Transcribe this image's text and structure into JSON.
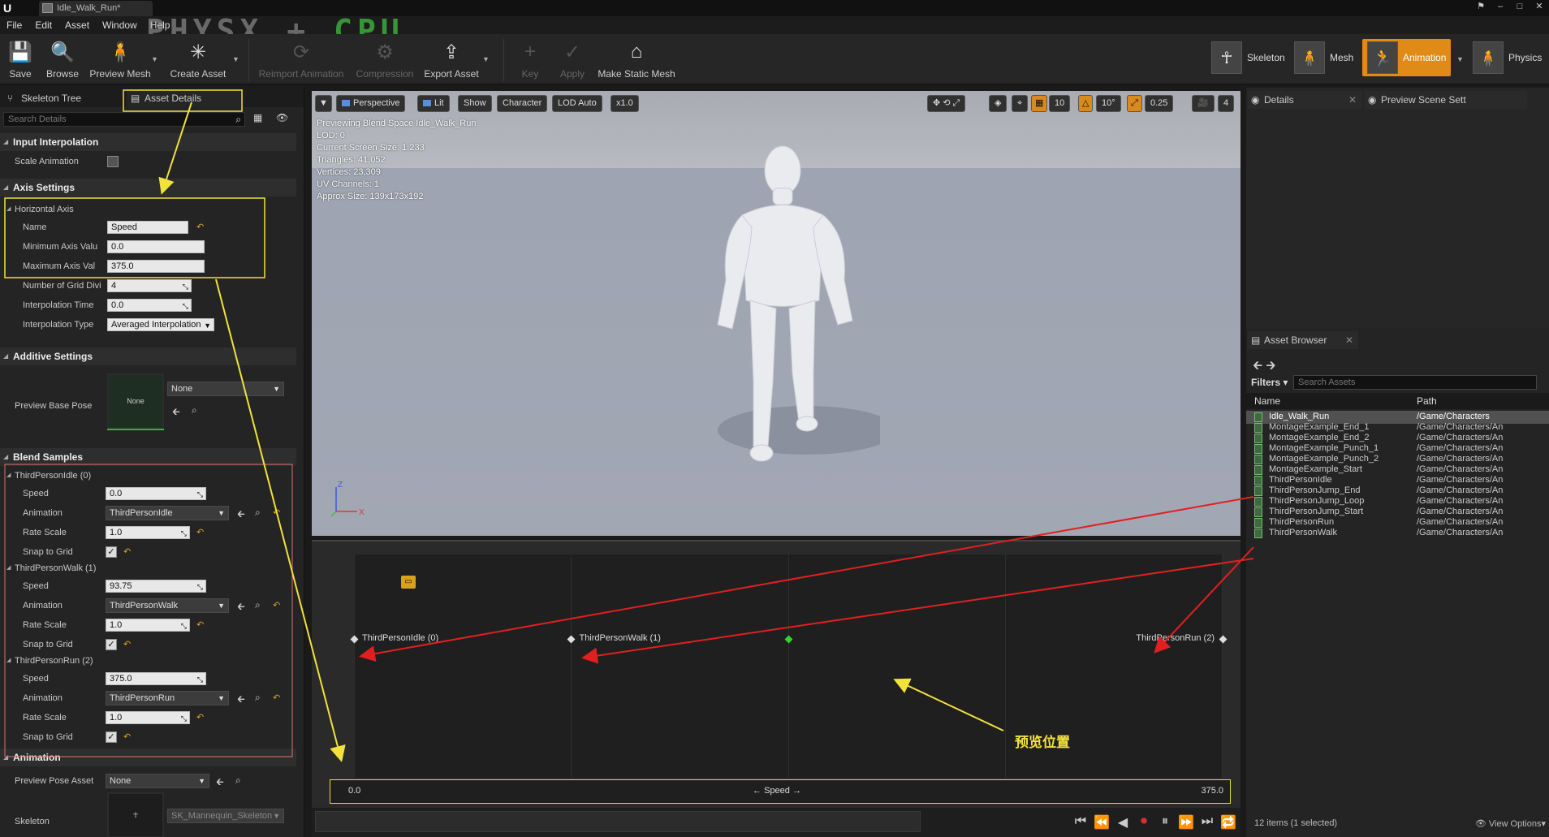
{
  "window": {
    "tab_title": "Idle_Walk_Run*",
    "watermark_left": "PHYSX",
    "watermark_plus": "+",
    "watermark_right": "CPU"
  },
  "menu": [
    "File",
    "Edit",
    "Asset",
    "Window",
    "Help"
  ],
  "toolbar": {
    "save": "Save",
    "browse": "Browse",
    "preview_mesh": "Preview Mesh",
    "create_asset": "Create Asset",
    "reimport_animation": "Reimport Animation",
    "compression": "Compression",
    "export_asset": "Export Asset",
    "key": "Key",
    "apply": "Apply",
    "make_static_mesh": "Make Static Mesh"
  },
  "modes": {
    "skeleton": "Skeleton",
    "mesh": "Mesh",
    "animation": "Animation",
    "physics": "Physics"
  },
  "left_panel": {
    "tab_skeleton_tree": "Skeleton Tree",
    "tab_asset_details": "Asset Details",
    "search_placeholder": "Search Details",
    "input_interpolation": "Input Interpolation",
    "scale_animation": "Scale Animation",
    "axis_settings": "Axis Settings",
    "horizontal_axis": "Horizontal Axis",
    "name_label": "Name",
    "name_value": "Speed",
    "min_axis_label": "Minimum Axis Valu",
    "min_axis_value": "0.0",
    "max_axis_label": "Maximum Axis Val",
    "max_axis_value": "375.0",
    "grid_div_label": "Number of Grid Divi",
    "grid_div_value": "4",
    "interp_time_label": "Interpolation Time",
    "interp_time_value": "0.0",
    "interp_type_label": "Interpolation Type",
    "interp_type_value": "Averaged Interpolation",
    "additive_settings": "Additive Settings",
    "preview_base_pose": "Preview Base Pose",
    "thumb_none": "None",
    "base_pose_value": "None",
    "blend_samples": "Blend Samples",
    "samples": [
      {
        "header": "ThirdPersonIdle (0)",
        "speed": "0.0",
        "animation": "ThirdPersonIdle",
        "rate": "1.0"
      },
      {
        "header": "ThirdPersonWalk (1)",
        "speed": "93.75",
        "animation": "ThirdPersonWalk",
        "rate": "1.0"
      },
      {
        "header": "ThirdPersonRun (2)",
        "speed": "375.0",
        "animation": "ThirdPersonRun",
        "rate": "1.0"
      }
    ],
    "speed_label": "Speed",
    "animation_label": "Animation",
    "rate_label": "Rate Scale",
    "snap_label": "Snap to Grid",
    "animation_cat": "Animation",
    "preview_pose_asset": "Preview Pose Asset",
    "preview_pose_value": "None",
    "skeleton_label": "Skeleton",
    "skeleton_value": "SK_Mannequin_Skeleton"
  },
  "viewport": {
    "perspective": "Perspective",
    "lit": "Lit",
    "show": "Show",
    "character": "Character",
    "lod": "LOD Auto",
    "speed": "x1.0",
    "grid_snap": "10",
    "rot_snap": "10°",
    "scale_snap": "0.25",
    "cam_speed": "4",
    "stats": [
      "Previewing Blend Space Idle_Walk_Run",
      "LOD: 0",
      "Current Screen Size: 1.233",
      "Triangles: 41,052",
      "Vertices: 23,309",
      "UV Channels: 1",
      "Approx Size: 139x173x192"
    ],
    "axis_z": "Z",
    "axis_x": "X"
  },
  "blend_space": {
    "samples": [
      {
        "label": "ThirdPersonIdle (0)",
        "speed": 0.0
      },
      {
        "label": "ThirdPersonWalk (1)",
        "speed": 93.75
      },
      {
        "label": "ThirdPersonRun (2)",
        "speed": 375.0
      }
    ],
    "preview_speed": 187.5,
    "axis_min": "0.0",
    "axis_max": "375.0",
    "axis_name": "Speed",
    "arrow_left": "←",
    "arrow_right": "→",
    "annotation": "预览位置"
  },
  "right_panel": {
    "tab_details": "Details",
    "tab_preview_scene": "Preview Scene Sett",
    "tab_asset_browser": "Asset Browser",
    "filters": "Filters",
    "search_placeholder": "Search Assets",
    "col_name": "Name",
    "col_path": "Path",
    "assets": [
      {
        "name": "Idle_Walk_Run",
        "path": "/Game/Characters"
      },
      {
        "name": "MontageExample_End_1",
        "path": "/Game/Characters/An"
      },
      {
        "name": "MontageExample_End_2",
        "path": "/Game/Characters/An"
      },
      {
        "name": "MontageExample_Punch_1",
        "path": "/Game/Characters/An"
      },
      {
        "name": "MontageExample_Punch_2",
        "path": "/Game/Characters/An"
      },
      {
        "name": "MontageExample_Start",
        "path": "/Game/Characters/An"
      },
      {
        "name": "ThirdPersonIdle",
        "path": "/Game/Characters/An"
      },
      {
        "name": "ThirdPersonJump_End",
        "path": "/Game/Characters/An"
      },
      {
        "name": "ThirdPersonJump_Loop",
        "path": "/Game/Characters/An"
      },
      {
        "name": "ThirdPersonJump_Start",
        "path": "/Game/Characters/An"
      },
      {
        "name": "ThirdPersonRun",
        "path": "/Game/Characters/An"
      },
      {
        "name": "ThirdPersonWalk",
        "path": "/Game/Characters/An"
      }
    ],
    "footer": "12 items (1 selected)",
    "view_options": "View Options"
  },
  "colors": {
    "accent": "#e08a17",
    "annotation_yellow": "#f2e23a",
    "annotation_red": "#e02020",
    "preview_marker": "#2fd82f"
  }
}
